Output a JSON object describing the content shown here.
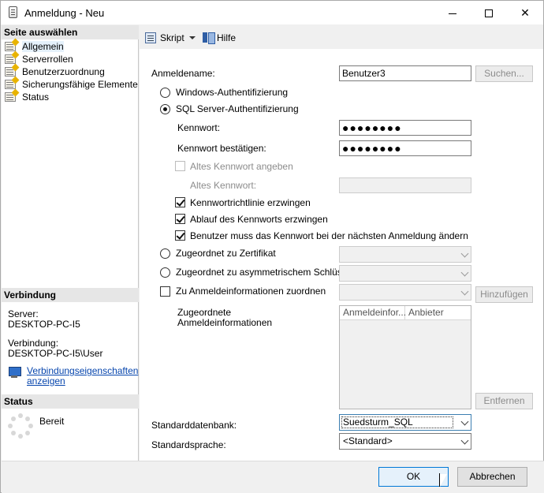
{
  "window": {
    "title": "Anmeldung - Neu"
  },
  "left": {
    "pages_header": "Seite auswählen",
    "pages": [
      {
        "label": "Allgemein",
        "selected": true
      },
      {
        "label": "Serverrollen"
      },
      {
        "label": "Benutzerzuordnung"
      },
      {
        "label": "Sicherungsfähige Elemente"
      },
      {
        "label": "Status"
      }
    ],
    "connection_header": "Verbindung",
    "server_label": "Server:",
    "server_value": "DESKTOP-PC-I5",
    "connection_label": "Verbindung:",
    "connection_value": "DESKTOP-PC-I5\\User",
    "connection_link": "Verbindungseigenschaften anzeigen",
    "status_header": "Status",
    "status_value": "Bereit"
  },
  "toolbar": {
    "script_label": "Skript",
    "help_label": "Hilfe"
  },
  "form": {
    "login_name_label": "Anmeldename:",
    "login_name_value": "Benutzer3",
    "search_button": "Suchen...",
    "windows_auth": "Windows-Authentifizierung",
    "sql_auth": "SQL Server-Authentifizierung",
    "password_label": "Kennwort:",
    "password_value": "●●●●●●●●",
    "confirm_label": "Kennwort bestätigen:",
    "confirm_value": "●●●●●●●●",
    "old_password_check": "Altes Kennwort angeben",
    "old_password_label": "Altes Kennwort:",
    "policy_check": "Kennwortrichtlinie erzwingen",
    "expiration_check": "Ablauf des Kennworts erzwingen",
    "must_change_check": "Benutzer muss das Kennwort bei der nächsten Anmeldung ändern",
    "cert_radio": "Zugeordnet zu Zertifikat",
    "asym_radio": "Zugeordnet zu asymmetrischem Schlüssel",
    "cred_check": "Zu Anmeldeinformationen zuordnen",
    "add_button": "Hinzufügen",
    "mapped_label_1": "Zugeordnete",
    "mapped_label_2": "Anmeldeinformationen",
    "grid_col_1": "Anmeldeinfor...",
    "grid_col_2": "Anbieter",
    "remove_button": "Entfernen",
    "default_db_label": "Standarddatenbank:",
    "default_db_value": "Suedsturm_SQL",
    "default_lang_label": "Standardsprache:",
    "default_lang_value": "<Standard>"
  },
  "buttons": {
    "ok": "OK",
    "cancel": "Abbrechen"
  }
}
